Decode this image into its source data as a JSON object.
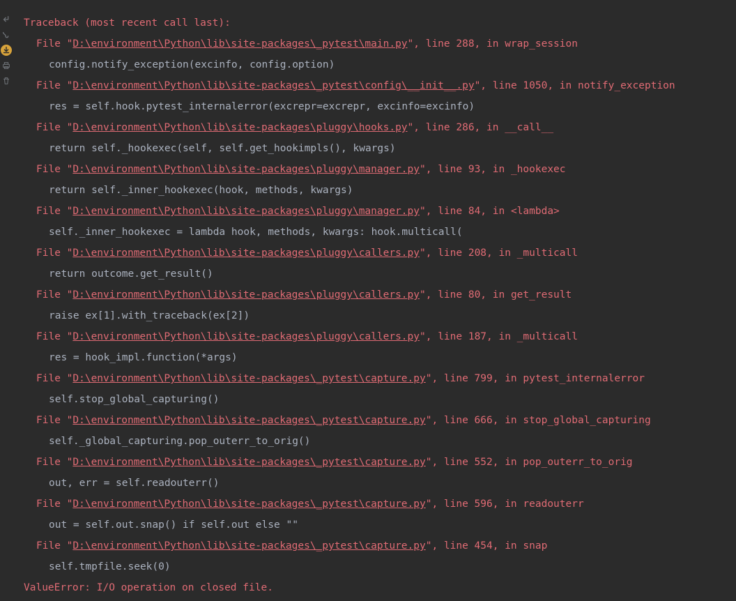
{
  "traceback": {
    "header": "Traceback (most recent call last):",
    "file_prefix": "File \"",
    "file_quote_close": "\"",
    "line_word": "line",
    "in_word": "in",
    "sep": ", ",
    "frames": [
      {
        "path": "D:\\environment\\Python\\lib\\site-packages\\_pytest\\main.py",
        "line": "288",
        "func": "wrap_session",
        "code": "config.notify_exception(excinfo, config.option)"
      },
      {
        "path": "D:\\environment\\Python\\lib\\site-packages\\_pytest\\config\\__init__.py",
        "line": "1050",
        "func": "notify_exception",
        "code": "res = self.hook.pytest_internalerror(excrepr=excrepr, excinfo=excinfo)"
      },
      {
        "path": "D:\\environment\\Python\\lib\\site-packages\\pluggy\\hooks.py",
        "line": "286",
        "func": "__call__",
        "code": "return self._hookexec(self, self.get_hookimpls(), kwargs)"
      },
      {
        "path": "D:\\environment\\Python\\lib\\site-packages\\pluggy\\manager.py",
        "line": "93",
        "func": "_hookexec",
        "code": "return self._inner_hookexec(hook, methods, kwargs)"
      },
      {
        "path": "D:\\environment\\Python\\lib\\site-packages\\pluggy\\manager.py",
        "line": "84",
        "func": "<lambda>",
        "code": "self._inner_hookexec = lambda hook, methods, kwargs: hook.multicall("
      },
      {
        "path": "D:\\environment\\Python\\lib\\site-packages\\pluggy\\callers.py",
        "line": "208",
        "func": "_multicall",
        "code": "return outcome.get_result()"
      },
      {
        "path": "D:\\environment\\Python\\lib\\site-packages\\pluggy\\callers.py",
        "line": "80",
        "func": "get_result",
        "code": "raise ex[1].with_traceback(ex[2])"
      },
      {
        "path": "D:\\environment\\Python\\lib\\site-packages\\pluggy\\callers.py",
        "line": "187",
        "func": "_multicall",
        "code": "res = hook_impl.function(*args)"
      },
      {
        "path": "D:\\environment\\Python\\lib\\site-packages\\_pytest\\capture.py",
        "line": "799",
        "func": "pytest_internalerror",
        "code": "self.stop_global_capturing()"
      },
      {
        "path": "D:\\environment\\Python\\lib\\site-packages\\_pytest\\capture.py",
        "line": "666",
        "func": "stop_global_capturing",
        "code": "self._global_capturing.pop_outerr_to_orig()"
      },
      {
        "path": "D:\\environment\\Python\\lib\\site-packages\\_pytest\\capture.py",
        "line": "552",
        "func": "pop_outerr_to_orig",
        "code": "out, err = self.readouterr()"
      },
      {
        "path": "D:\\environment\\Python\\lib\\site-packages\\_pytest\\capture.py",
        "line": "596",
        "func": "readouterr",
        "code": "out = self.out.snap() if self.out else \"\""
      },
      {
        "path": "D:\\environment\\Python\\lib\\site-packages\\_pytest\\capture.py",
        "line": "454",
        "func": "snap",
        "code": "self.tmpfile.seek(0)"
      }
    ],
    "exception": "ValueError: I/O operation on closed file."
  }
}
